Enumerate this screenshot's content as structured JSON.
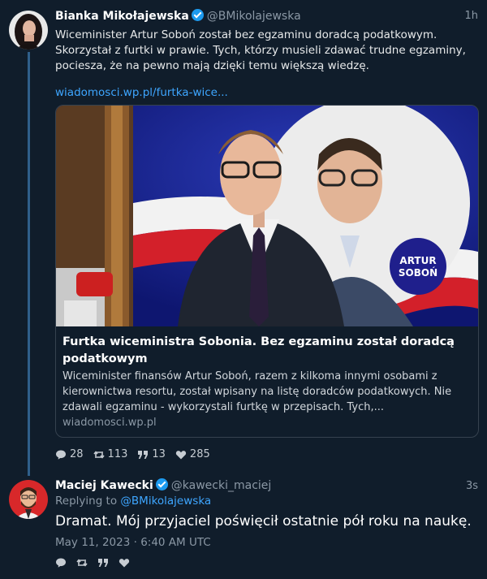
{
  "tweet1": {
    "display_name": "Bianka Mikołajewska",
    "handle": "@BMikolajewska",
    "time": "1h",
    "text_lines": [
      "Wiceminister Artur Soboń został bez egzaminu doradcą podatkowym.",
      "Skorzystał z furtki w prawie. Tych, którzy musieli zdawać trudne egzaminy,",
      "pociesza, że na pewno mają dzięki temu większą wiedzę."
    ],
    "link": "wiadomosci.wp.pl/furtka-wice...",
    "card": {
      "image_badge_line1": "ARTUR",
      "image_badge_line2": "SOBOŃ",
      "title": "Furtka wiceministra Sobonia. Bez egzaminu został doradcą podatkowym",
      "description": "Wiceminister finansów Artur Soboń, razem z kilkoma innymi osobami z kierownictwa resortu, został wpisany na listę doradców podatkowych. Nie zdawali egzaminu - wykorzystali furtkę w przepisach. Tych,...",
      "domain": "wiadomosci.wp.pl"
    },
    "stats": {
      "comments": "28",
      "retweets": "113",
      "quotes": "13",
      "likes": "285"
    }
  },
  "tweet2": {
    "display_name": "Maciej Kawecki",
    "handle": "@kawecki_maciej",
    "time": "3s",
    "replying_prefix": "Replying to",
    "replying_handle": "@BMikolajewska",
    "text": "Dramat. Mój przyjaciel poświęcił ostatnie pół roku na naukę.",
    "date": "May 11, 2023 · 6:40 AM UTC"
  },
  "icons": {
    "comment": "comment-icon",
    "retweet": "retweet-icon",
    "quote": "quote-icon",
    "like": "heart-icon",
    "verified": "verified-badge-icon"
  },
  "colors": {
    "background": "#101d2b",
    "link": "#3ea6ff",
    "verified": "#1d9bf0",
    "thread_line": "#2f5f8a"
  }
}
